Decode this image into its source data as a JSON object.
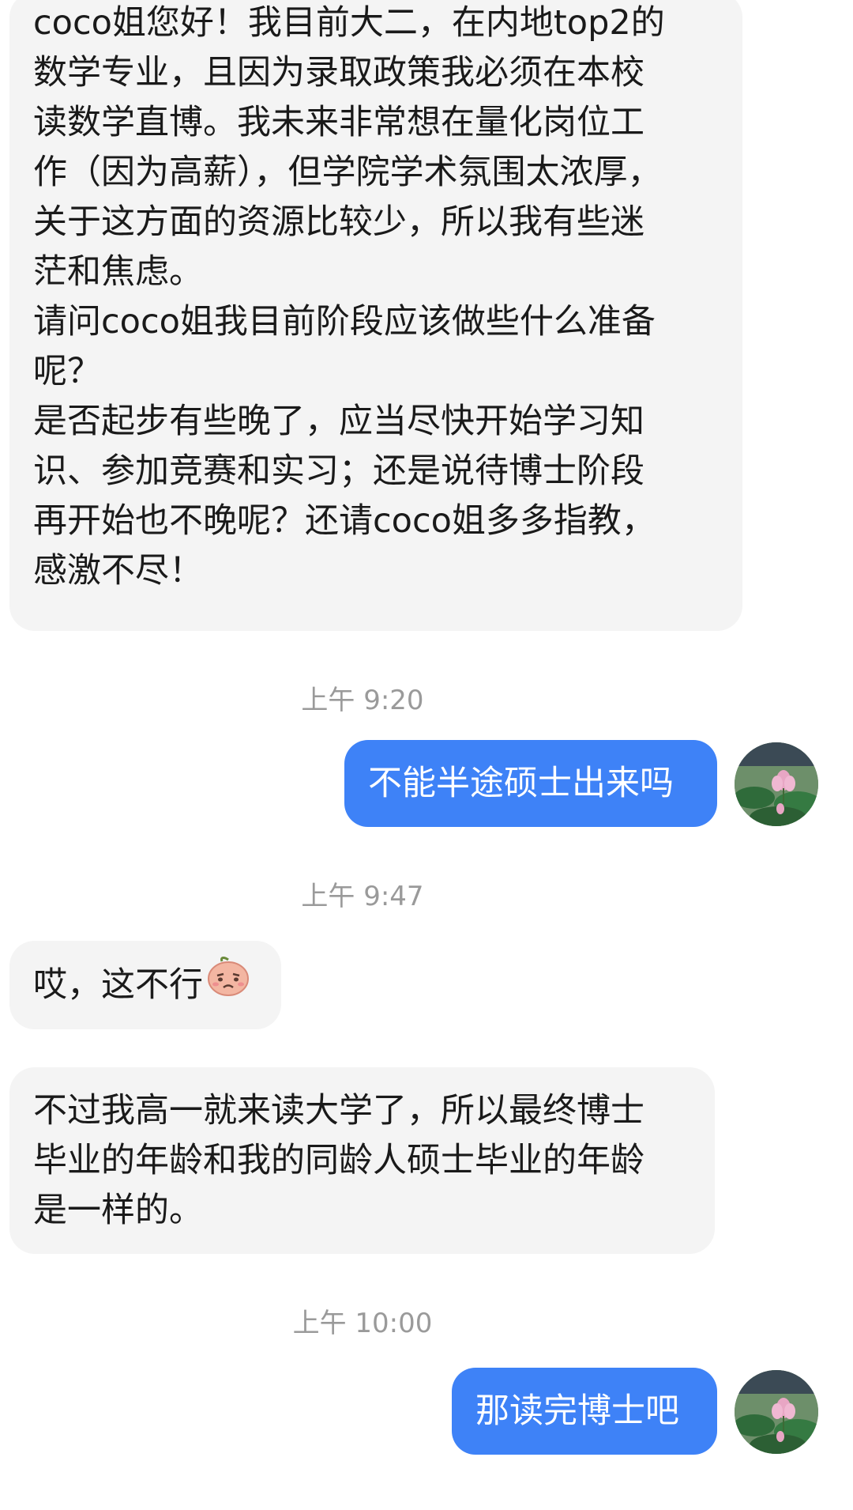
{
  "messages": {
    "m1": {
      "text": "coco姐您好！我目前大二，在内地top2的\n数学专业，且因为录取政策我必须在本校\n读数学直博。我未来非常想在量化岗位工\n作（因为高薪），但学院学术氛围太浓厚，\n关于这方面的资源比较少，所以我有些迷\n茫和焦虑。\n请问coco姐我目前阶段应该做些什么准备\n呢？\n是否起步有些晚了，应当尽快开始学习知\n识、参加竞赛和实习；还是说待博士阶段\n再开始也不晚呢？还请coco姐多多指教，\n感激不尽！"
    },
    "t1": "上午 9:20",
    "m2": {
      "text": "不能半途硕士出来吗"
    },
    "t2": "上午 9:47",
    "m3": {
      "text": "哎，这不行",
      "emoji": "sad-peach-sticker"
    },
    "m4": {
      "text": "不过我高一就来读大学了，所以最终博士\n毕业的年龄和我的同龄人硕士毕业的年龄\n是一样的。"
    },
    "t3": "上午 10:00",
    "m5": {
      "text": "那读完博士吧"
    },
    "colors": {
      "incoming_bubble": "#f4f4f4",
      "outgoing_bubble": "#3e82f7",
      "timestamp": "#9a9a9a"
    }
  }
}
